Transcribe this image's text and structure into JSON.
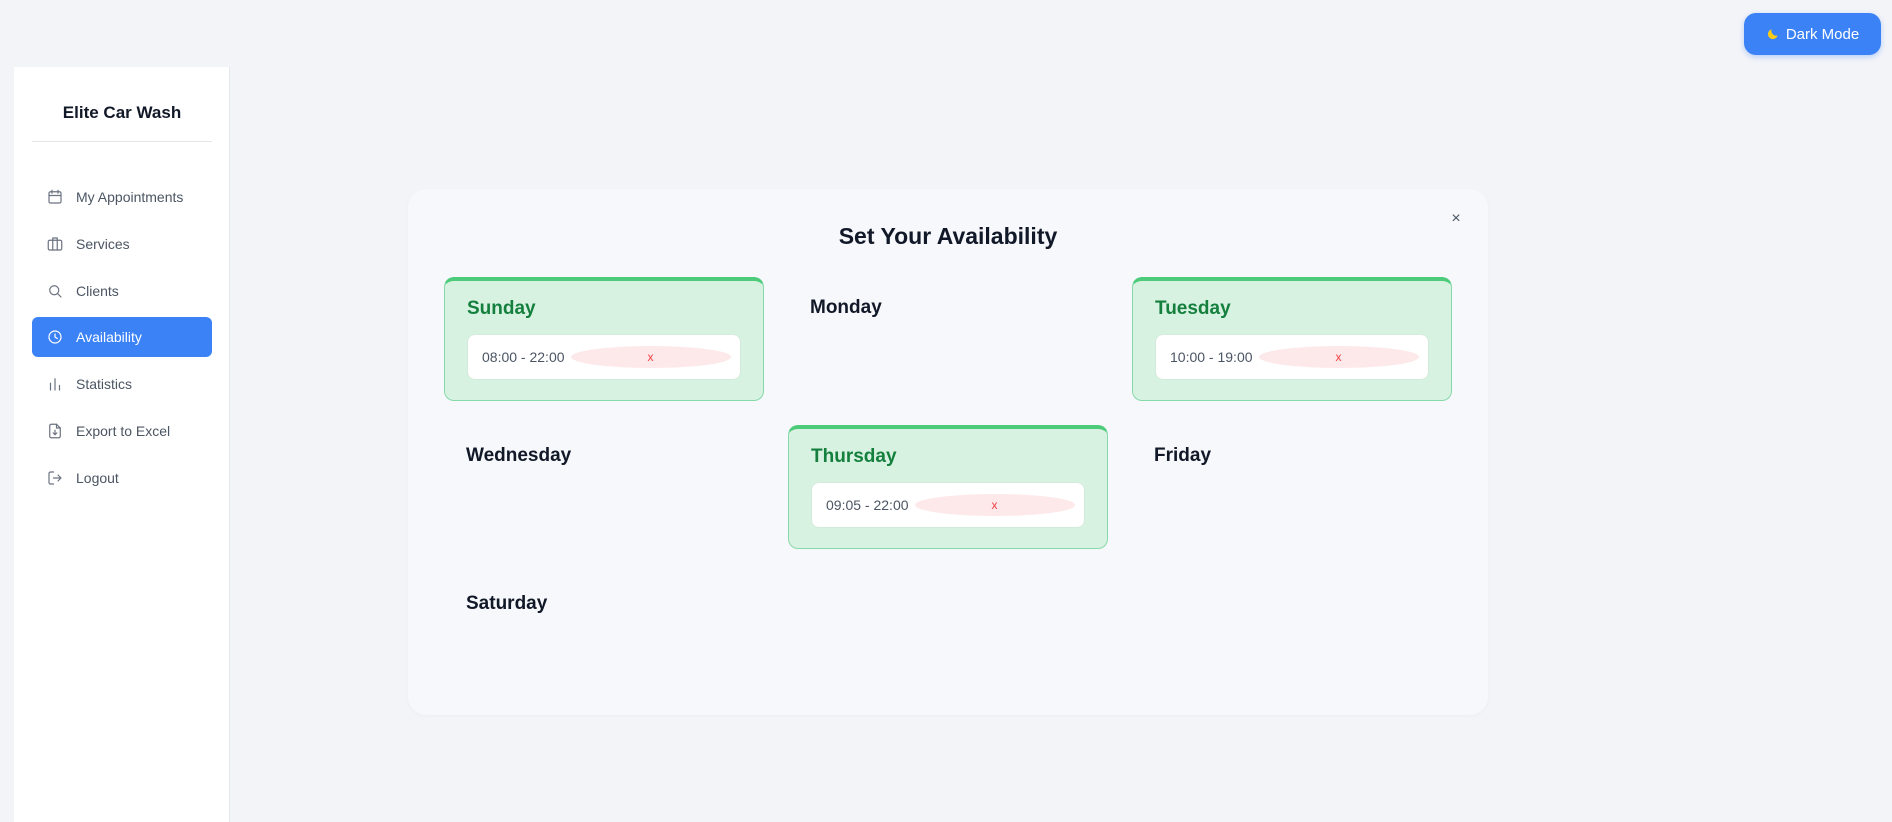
{
  "header": {
    "dark_mode_label": "Dark Mode",
    "dark_mode_icon": "moon-icon"
  },
  "sidebar": {
    "brand": "Elite Car Wash",
    "items": [
      {
        "label": "My Appointments",
        "icon": "calendar-icon"
      },
      {
        "label": "Services",
        "icon": "briefcase-icon"
      },
      {
        "label": "Clients",
        "icon": "search-icon"
      },
      {
        "label": "Availability",
        "icon": "clock-icon",
        "active": true
      },
      {
        "label": "Statistics",
        "icon": "bar-chart-icon"
      },
      {
        "label": "Export to Excel",
        "icon": "file-download-icon"
      },
      {
        "label": "Logout",
        "icon": "logout-icon"
      }
    ]
  },
  "modal": {
    "title": "Set Your Availability",
    "close_label": "×",
    "days": [
      {
        "name": "Sunday",
        "slots": [
          "08:00 - 22:00"
        ]
      },
      {
        "name": "Monday",
        "slots": []
      },
      {
        "name": "Tuesday",
        "slots": [
          "10:00 - 19:00"
        ]
      },
      {
        "name": "Wednesday",
        "slots": []
      },
      {
        "name": "Thursday",
        "slots": [
          "09:05 - 22:00"
        ]
      },
      {
        "name": "Friday",
        "slots": []
      },
      {
        "name": "Saturday",
        "slots": []
      }
    ],
    "remove_label": "x"
  },
  "colors": {
    "accent": "#3b82f6",
    "active_day_bg": "#d8f2e2",
    "active_day_text": "#15803d",
    "remove": "#ef4444"
  }
}
